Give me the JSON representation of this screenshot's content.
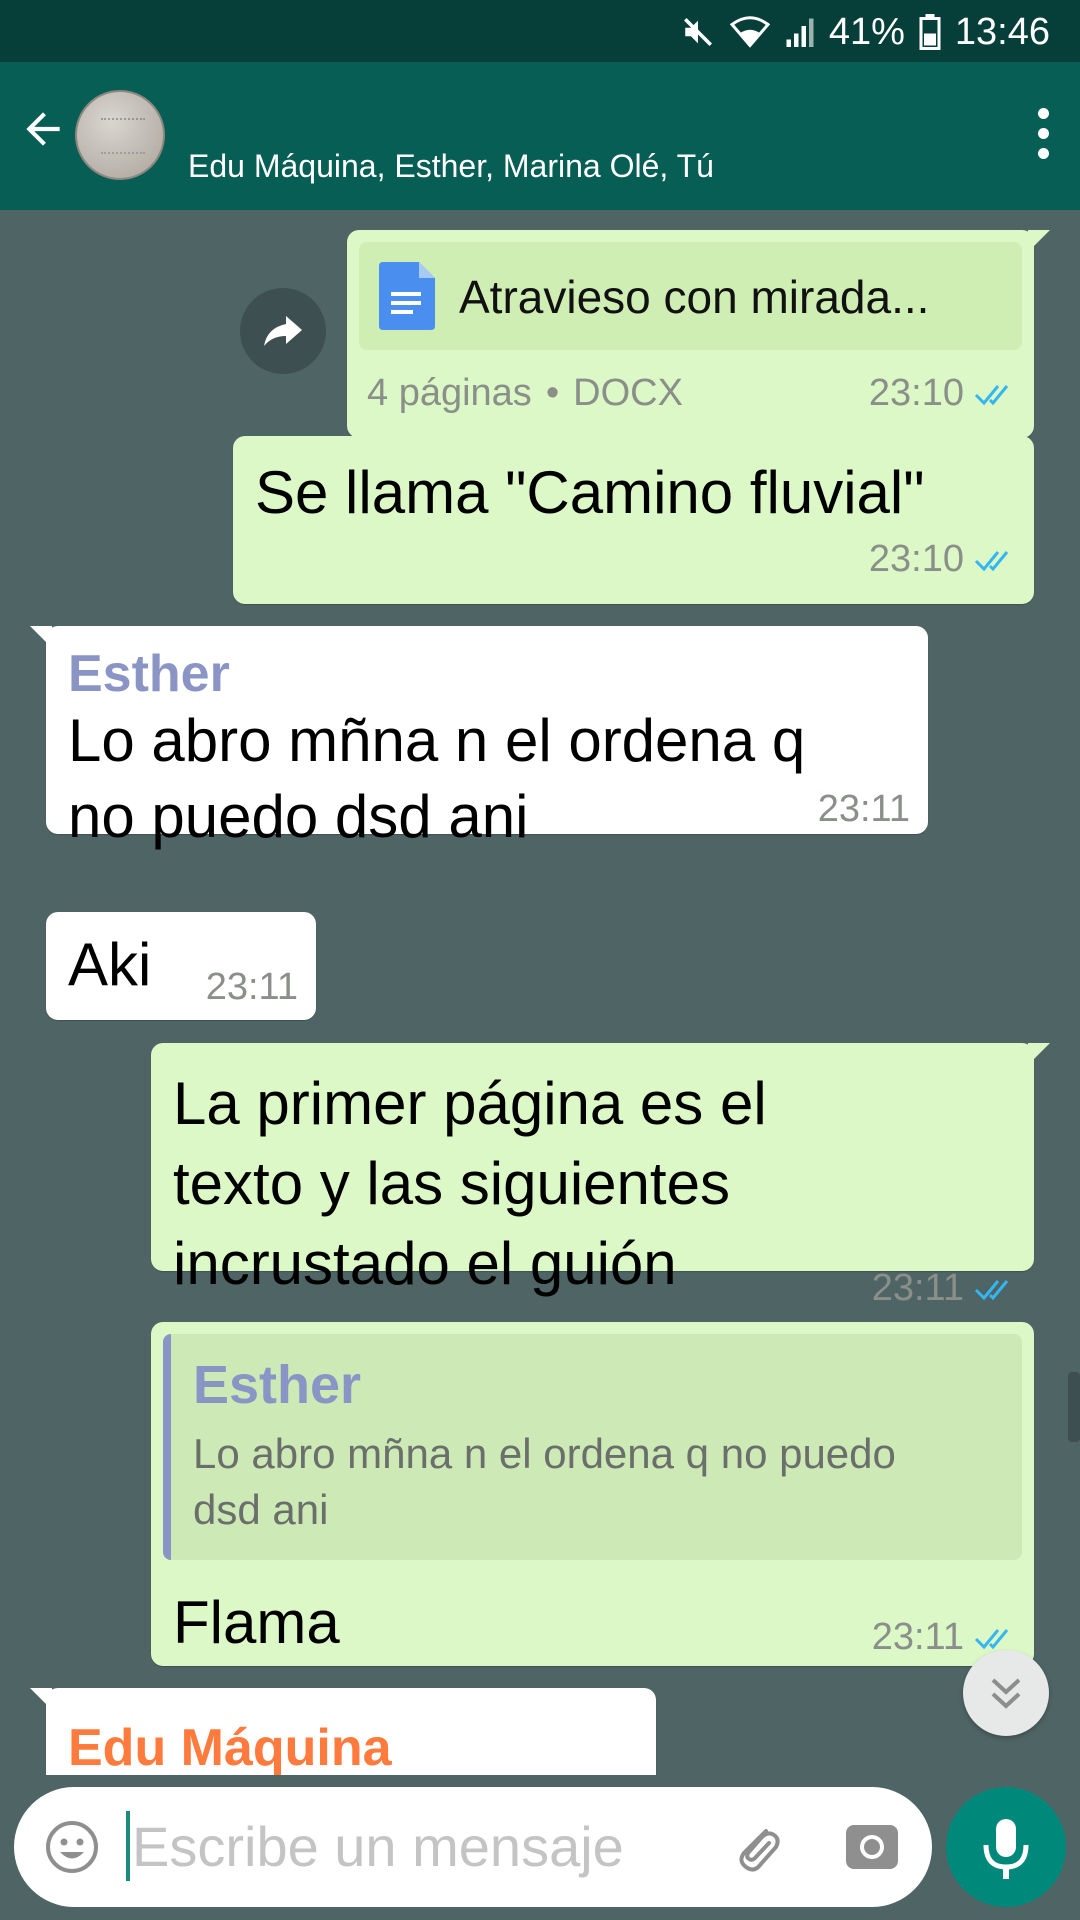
{
  "status_bar": {
    "battery": "41%",
    "time": "13:46"
  },
  "header": {
    "participants": "Edu Máquina, Esther, Marina Olé, Tú"
  },
  "messages": {
    "doc": {
      "filename": "Atravieso con mirada...",
      "pages": "4 páginas",
      "type": "DOCX",
      "time": "23:10"
    },
    "m1": {
      "text": "Se llama \"Camino fluvial\"",
      "time": "23:10"
    },
    "m2": {
      "sender": "Esther",
      "line1": "Lo abro mñna n el ordena q",
      "line2": "no puedo dsd ani",
      "time": "23:11"
    },
    "m3": {
      "text": "Aki",
      "time": "23:11"
    },
    "m4": {
      "line1": "La primer página es el",
      "line2": "texto y las siguientes",
      "line3": "incrustado el guión",
      "time": "23:11"
    },
    "m5": {
      "quote_sender": "Esther",
      "quote_line1": "Lo abro mñna n el ordena q no puedo",
      "quote_line2": "dsd ani",
      "text": "Flama",
      "time": "23:11"
    },
    "m6": {
      "sender": "Edu Máquina"
    }
  },
  "input": {
    "placeholder": "Escribe un mensaje"
  },
  "colors": {
    "header": "#075e54",
    "outgoing": "#dcf8c6",
    "incoming": "#ffffff",
    "accent": "#00897b",
    "read_ticks": "#34b7f1"
  },
  "icons": [
    "back-arrow-icon",
    "more-vert-icon",
    "mute-icon",
    "wifi-icon",
    "signal-icon",
    "battery-icon",
    "document-icon",
    "forward-icon",
    "double-check-icon",
    "chevron-double-down-icon",
    "emoji-icon",
    "attach-icon",
    "camera-icon",
    "mic-icon"
  ]
}
